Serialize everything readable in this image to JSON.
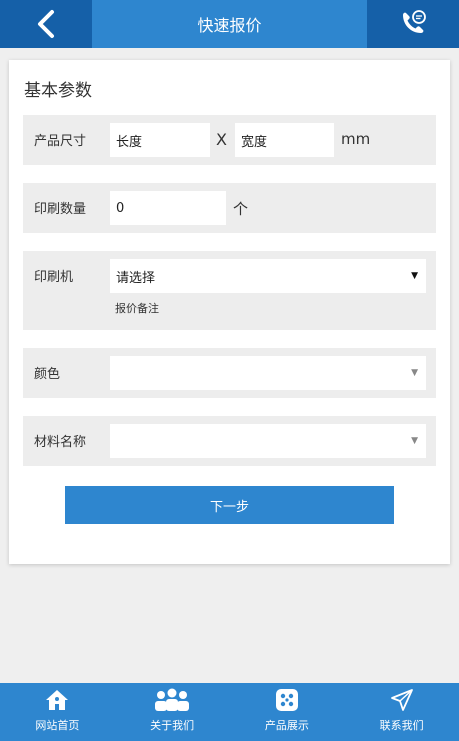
{
  "header": {
    "title": "快速报价"
  },
  "section": {
    "title": "基本参数"
  },
  "form": {
    "size": {
      "label": "产品尺寸",
      "length_placeholder": "长度",
      "separator": "X",
      "width_placeholder": "宽度",
      "unit": "mm"
    },
    "quantity": {
      "label": "印刷数量",
      "value": "0",
      "unit": "个"
    },
    "printer": {
      "label": "印刷机",
      "selected": "请选择",
      "note": "报价备注"
    },
    "color": {
      "label": "颜色",
      "selected": ""
    },
    "material": {
      "label": "材料名称",
      "selected": ""
    },
    "next_label": "下一步"
  },
  "nav": {
    "items": [
      {
        "label": "网站首页",
        "icon": "home-icon"
      },
      {
        "label": "关于我们",
        "icon": "users-icon"
      },
      {
        "label": "产品展示",
        "icon": "grid-icon"
      },
      {
        "label": "联系我们",
        "icon": "send-icon"
      }
    ]
  },
  "colors": {
    "primary": "#2e86cf",
    "primary_dark": "#1560a8"
  }
}
